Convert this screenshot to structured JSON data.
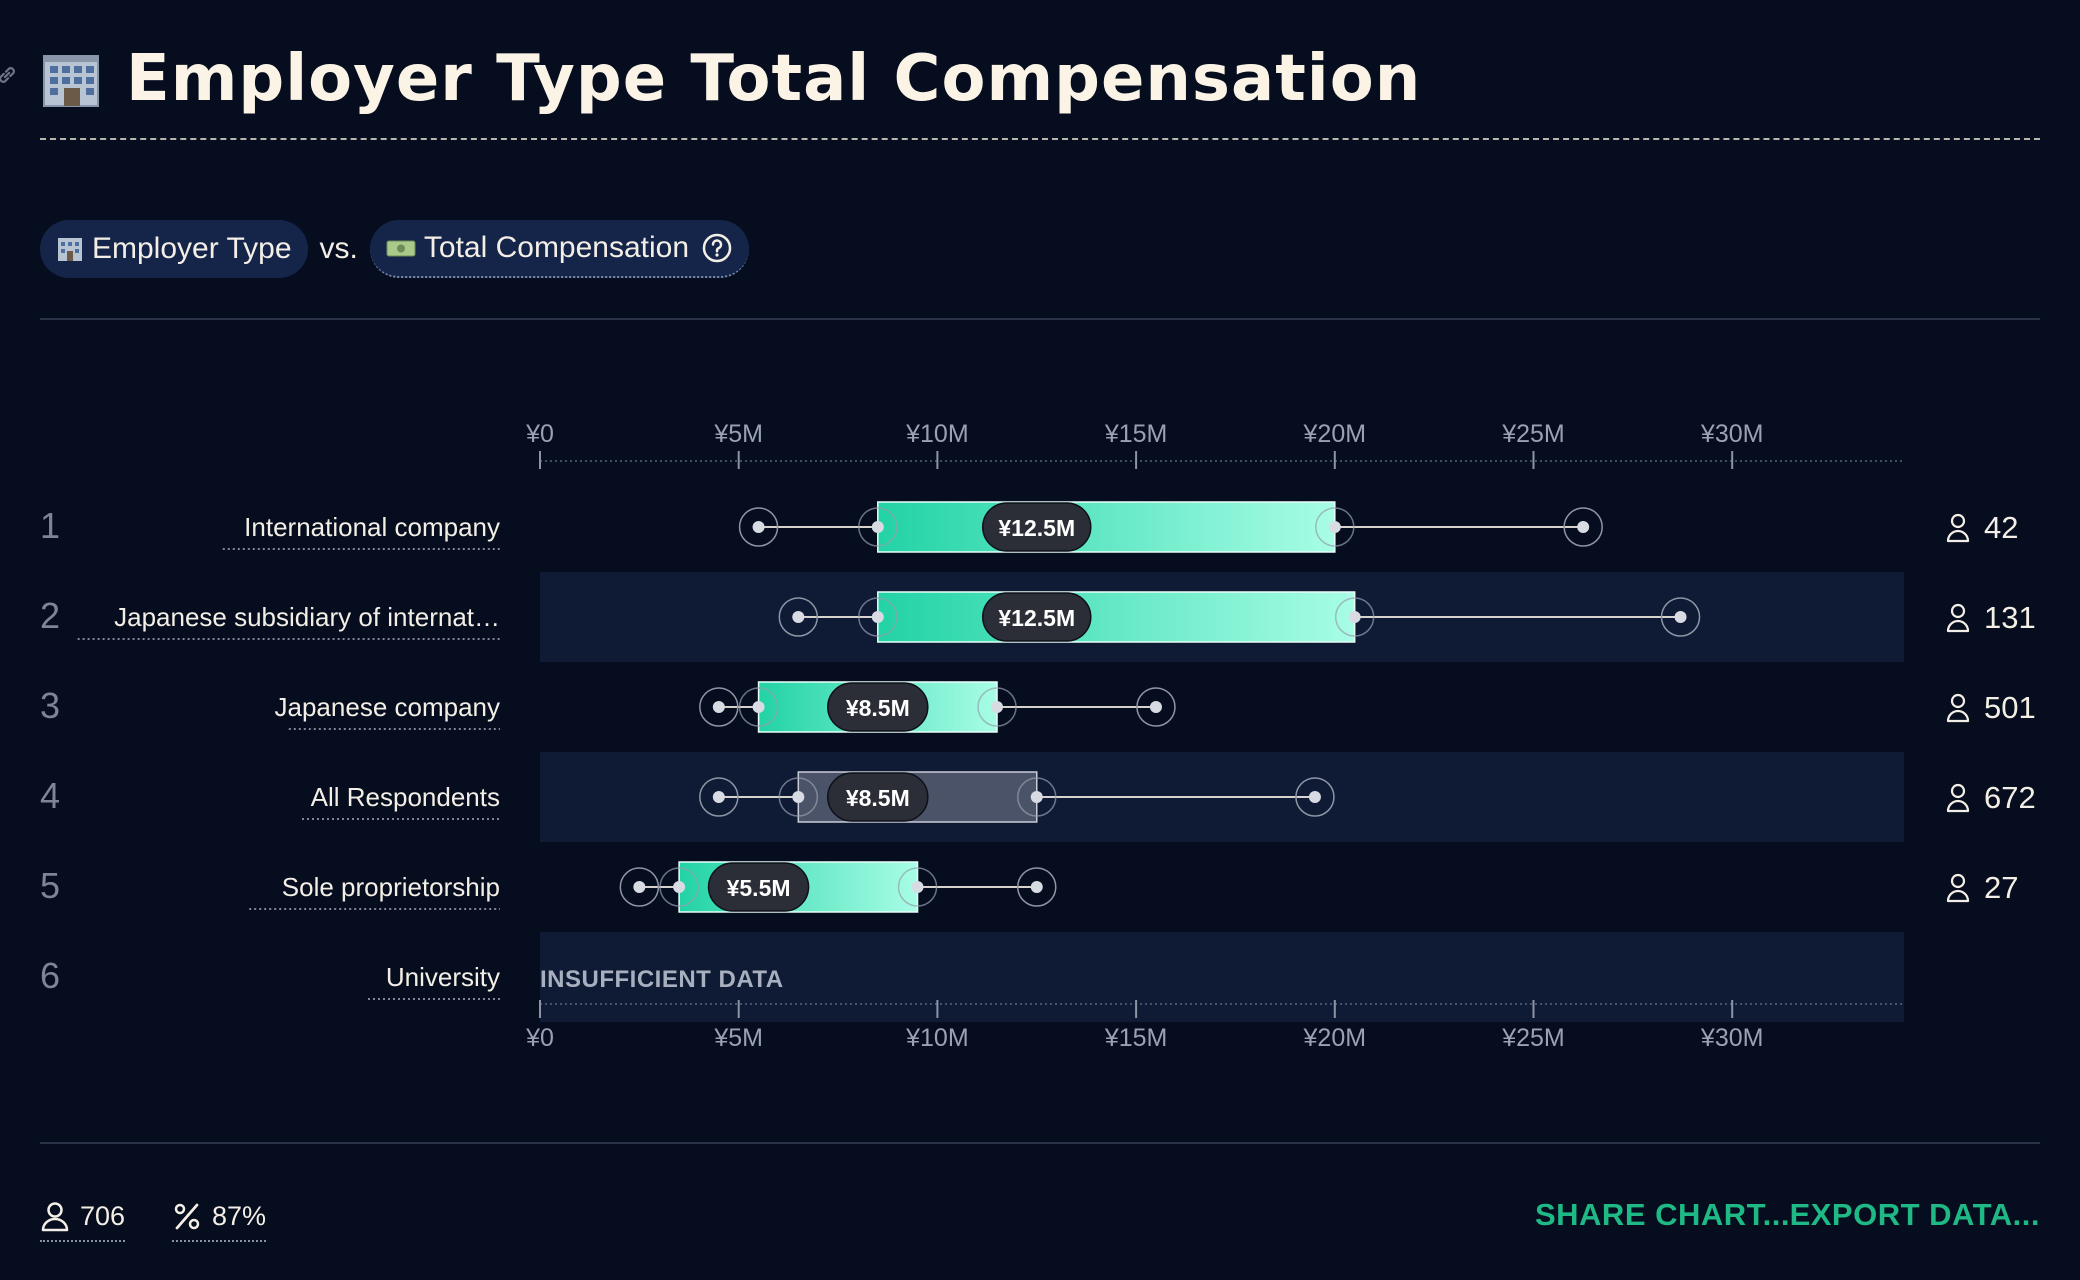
{
  "page": {
    "title": "Employer Type Total Compensation",
    "pill_x": "Employer Type",
    "vs": "vs.",
    "pill_y": "Total Compensation"
  },
  "chart_data": {
    "type": "box",
    "xlim": [
      0,
      34.3
    ],
    "ticks": [
      {
        "value": 0,
        "label": "¥0"
      },
      {
        "value": 5,
        "label": "¥5M"
      },
      {
        "value": 10,
        "label": "¥10M"
      },
      {
        "value": 15,
        "label": "¥15M"
      },
      {
        "value": 20,
        "label": "¥20M"
      },
      {
        "value": 25,
        "label": "¥25M"
      },
      {
        "value": 30,
        "label": "¥30M"
      }
    ],
    "unit": "¥ millions",
    "rows": [
      {
        "rank": "1",
        "label": "International company",
        "whisker_low": 5.5,
        "q1": 8.5,
        "median": 12.5,
        "q3": 20.0,
        "whisker_high": 26.25,
        "median_label": "¥12.5M",
        "n": "42",
        "style": "gradient"
      },
      {
        "rank": "2",
        "label": "Japanese subsidiary of internat…",
        "whisker_low": 6.5,
        "q1": 8.5,
        "median": 12.5,
        "q3": 20.5,
        "whisker_high": 28.7,
        "median_label": "¥12.5M",
        "n": "131",
        "style": "gradient"
      },
      {
        "rank": "3",
        "label": "Japanese company",
        "whisker_low": 4.5,
        "q1": 5.5,
        "median": 8.5,
        "q3": 11.5,
        "whisker_high": 15.5,
        "median_label": "¥8.5M",
        "n": "501",
        "style": "gradient"
      },
      {
        "rank": "4",
        "label": "All Respondents",
        "whisker_low": 4.5,
        "q1": 6.5,
        "median": 8.5,
        "q3": 12.5,
        "whisker_high": 19.5,
        "median_label": "¥8.5M",
        "n": "672",
        "style": "reference"
      },
      {
        "rank": "5",
        "label": "Sole proprietorship",
        "whisker_low": 2.5,
        "q1": 3.5,
        "median": 5.5,
        "q3": 9.5,
        "whisker_high": 12.5,
        "median_label": "¥5.5M",
        "n": "27",
        "style": "gradient"
      },
      {
        "rank": "6",
        "label": "University",
        "insufficient": "INSUFFICIENT DATA"
      }
    ]
  },
  "footer": {
    "respondents": "706",
    "percent": "87%",
    "share_label": "SHARE CHART...",
    "export_label": "EXPORT DATA..."
  },
  "colors": {
    "background": "#050d1e",
    "band": "#0f1a35",
    "box_start": "#22d3a5",
    "box_end": "#a8fde6",
    "reference_box": "#4a5368",
    "accent": "#1fb985"
  },
  "icons": [
    "link-icon",
    "office-building-icon",
    "money-icon",
    "help-circle-icon",
    "person-icon",
    "percent-icon"
  ]
}
